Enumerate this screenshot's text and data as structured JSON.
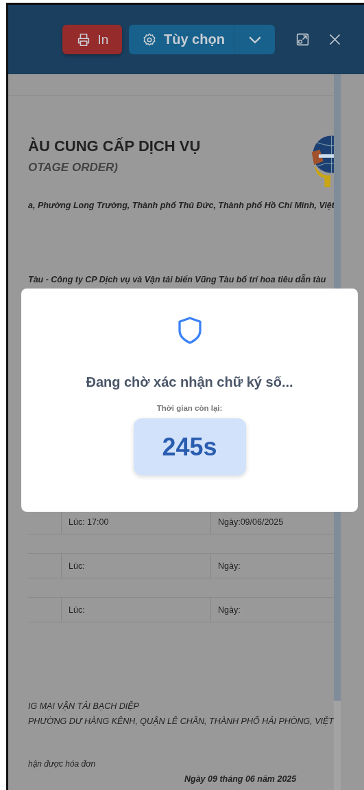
{
  "toolbar": {
    "print_button": "In",
    "options_button": "Tùy chọn"
  },
  "document": {
    "title": "ÀU CUNG CẤP DỊCH VỤ",
    "subtitle": "OTAGE ORDER)",
    "address": "a, Phường Long Trường, Thành phố Thủ Đức, Thành phố Hồ Chí Minh, Việt",
    "intro": "Tàu - Công ty CP Dịch vụ và Vận tải biển Vũng Tàu bố trí hoa tiêu dẫn tàu",
    "rows": [
      {
        "time": "Lúc: 17:00",
        "date": "Ngày:09/06/2025"
      },
      {
        "time": "Lúc:",
        "date": "Ngày:"
      },
      {
        "time": "Lúc:",
        "date": "Ngày:"
      }
    ],
    "company": "IG MẠI VẬN TẢI BẠCH DIỆP",
    "company_address": "PHƯỜNG DƯ HÀNG KÊNH, QUẬN LÊ CHÂN, THÀNH PHỐ HẢI PHÒNG, VIỆT",
    "invoice_note": "hận được hóa đơn",
    "date_line": "Ngày 09 tháng 06 năm 2025"
  },
  "modal": {
    "title": "Đang chờ xác nhận chữ ký số...",
    "countdown_label": "Thời gian còn lại:",
    "countdown": "245s"
  }
}
